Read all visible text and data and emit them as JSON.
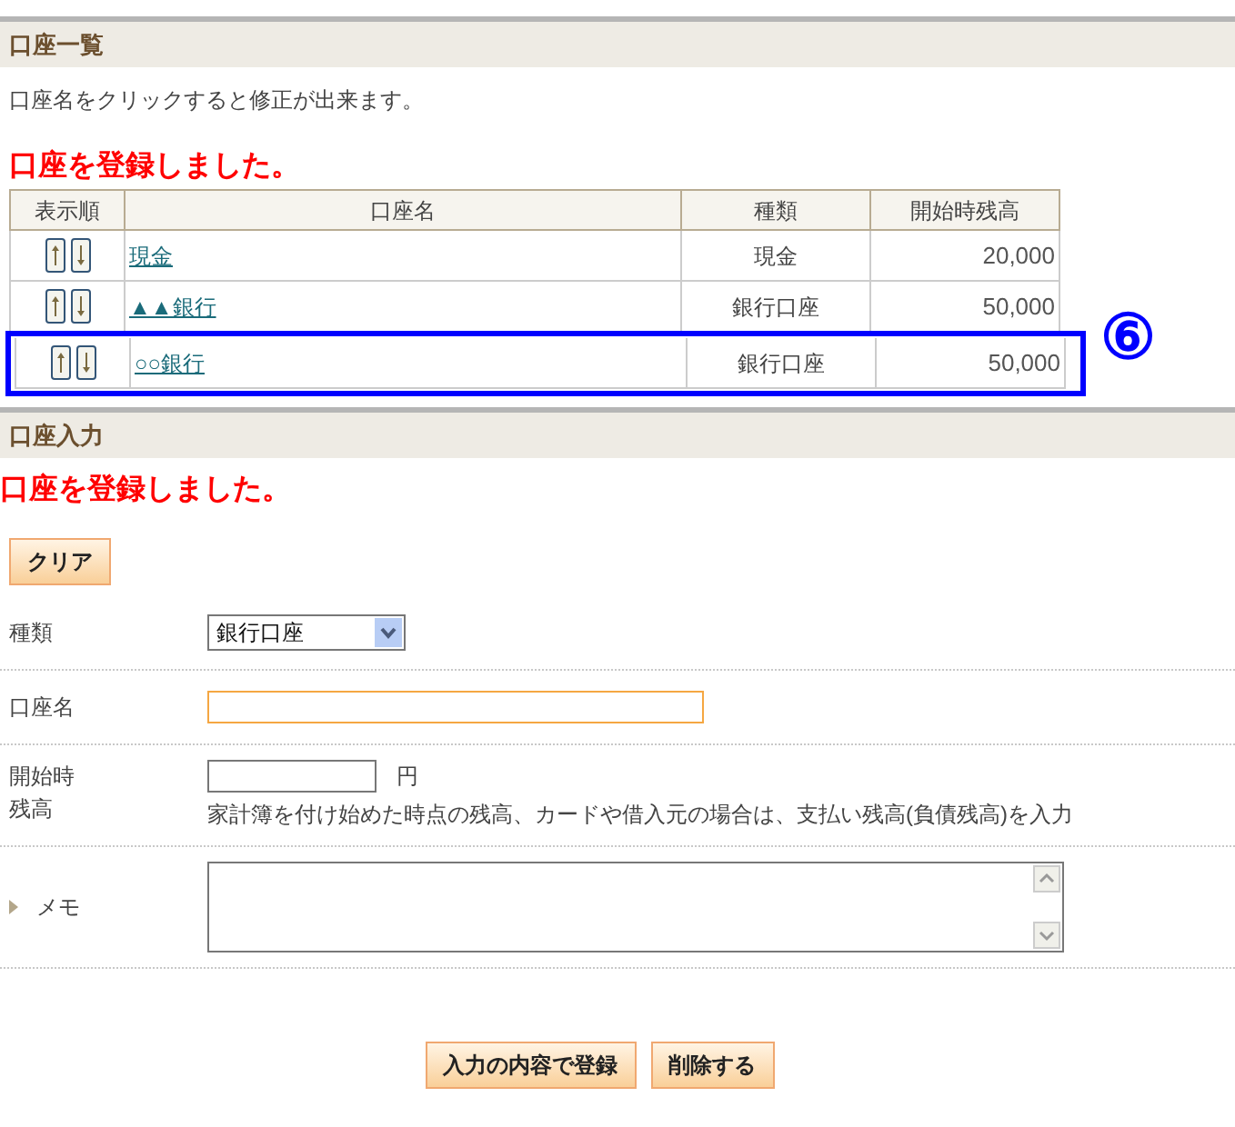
{
  "list_section": {
    "title": "口座一覧",
    "hint": "口座名をクリックすると修正が出来ます。",
    "message": "口座を登録しました。",
    "columns": [
      "表示順",
      "口座名",
      "種類",
      "開始時残高"
    ],
    "rows": [
      {
        "name": "現金",
        "type": "現金",
        "balance": "20,000",
        "highlighted": false
      },
      {
        "name": "▲▲銀行",
        "type": "銀行口座",
        "balance": "50,000",
        "highlighted": false
      },
      {
        "name": "○○銀行",
        "type": "銀行口座",
        "balance": "50,000",
        "highlighted": true
      }
    ],
    "annotation": "⑥"
  },
  "input_section": {
    "title": "口座入力",
    "message": "口座を登録しました。",
    "clear_button": "クリア",
    "fields": [
      {
        "kind": "select",
        "label": "種類",
        "value": "銀行口座"
      },
      {
        "kind": "text",
        "label": "口座名"
      },
      {
        "kind": "amount",
        "label": "開始時残高",
        "unit": "円",
        "note": "家計簿を付け始めた時点の残高、カードや借入元の場合は、支払い残高(負債残高)を入力"
      },
      {
        "kind": "memo",
        "label": "メモ"
      }
    ],
    "buttons": [
      "入力の内容で登録",
      "削除する"
    ]
  }
}
